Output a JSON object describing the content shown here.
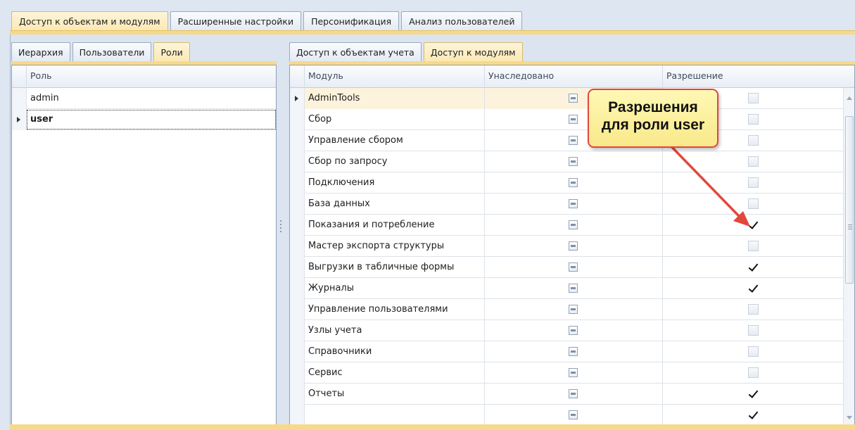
{
  "top_tabs": [
    {
      "label": "Доступ к объектам и модулям",
      "active": true
    },
    {
      "label": "Расширенные настройки",
      "active": false
    },
    {
      "label": "Персонификация",
      "active": false
    },
    {
      "label": "Анализ пользователей",
      "active": false
    }
  ],
  "left_tabs": [
    {
      "label": "Иерархия",
      "active": false
    },
    {
      "label": "Пользователи",
      "active": false
    },
    {
      "label": "Роли",
      "active": true
    }
  ],
  "right_tabs": [
    {
      "label": "Доступ к объектам учета",
      "active": false
    },
    {
      "label": "Доступ к модулям",
      "active": true
    }
  ],
  "roles_grid": {
    "header": "Роль",
    "rows": [
      {
        "name": "admin",
        "selected": false
      },
      {
        "name": "user",
        "selected": true
      }
    ]
  },
  "modules_grid": {
    "headers": {
      "module": "Модуль",
      "inherited": "Унаследовано",
      "permission": "Разрешение"
    },
    "rows": [
      {
        "module": "AdminTools",
        "inherited": "indeterminate",
        "permission": false,
        "current": true
      },
      {
        "module": "Сбор",
        "inherited": "indeterminate",
        "permission": false
      },
      {
        "module": "Управление сбором",
        "inherited": "indeterminate",
        "permission": false
      },
      {
        "module": "Сбор по запросу",
        "inherited": "indeterminate",
        "permission": false
      },
      {
        "module": "Подключения",
        "inherited": "indeterminate",
        "permission": false
      },
      {
        "module": "База данных",
        "inherited": "indeterminate",
        "permission": false
      },
      {
        "module": "Показания и потребление",
        "inherited": "indeterminate",
        "permission": true
      },
      {
        "module": "Мастер экспорта структуры",
        "inherited": "indeterminate",
        "permission": false
      },
      {
        "module": "Выгрузки в табличные формы",
        "inherited": "indeterminate",
        "permission": true
      },
      {
        "module": "Журналы",
        "inherited": "indeterminate",
        "permission": true
      },
      {
        "module": "Управление пользователями",
        "inherited": "indeterminate",
        "permission": false
      },
      {
        "module": "Узлы учета",
        "inherited": "indeterminate",
        "permission": false
      },
      {
        "module": "Справочники",
        "inherited": "indeterminate",
        "permission": false
      },
      {
        "module": "Сервис",
        "inherited": "indeterminate",
        "permission": false
      },
      {
        "module": "Отчеты",
        "inherited": "indeterminate",
        "permission": true
      },
      {
        "module": "",
        "inherited": "indeterminate",
        "permission": true
      }
    ]
  },
  "callout": {
    "line1": "Разрешения",
    "line2": "для роли user"
  },
  "colors": {
    "tab_accent": "#f7d98b",
    "callout_border": "#e2473d",
    "callout_fill": "#f9e98a"
  }
}
